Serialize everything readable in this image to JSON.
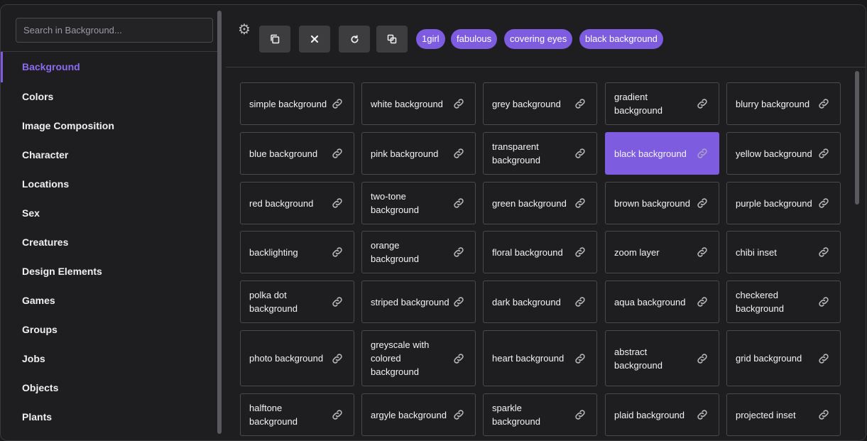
{
  "sidebar": {
    "search_placeholder": "Search in Background...",
    "items": [
      {
        "label": "Background",
        "active": true
      },
      {
        "label": "Colors"
      },
      {
        "label": "Image Composition"
      },
      {
        "label": "Character"
      },
      {
        "label": "Locations"
      },
      {
        "label": "Sex"
      },
      {
        "label": "Creatures"
      },
      {
        "label": "Design Elements"
      },
      {
        "label": "Games"
      },
      {
        "label": "Groups"
      },
      {
        "label": "Jobs"
      },
      {
        "label": "Objects"
      },
      {
        "label": "Plants"
      }
    ]
  },
  "toolbar": {
    "buttons": [
      {
        "name": "copy-button",
        "icon": "copy-icon"
      },
      {
        "name": "clear-button",
        "icon": "close-icon"
      },
      {
        "name": "refresh-button",
        "icon": "refresh-icon"
      },
      {
        "name": "duplicate-button",
        "icon": "duplicate-icon"
      }
    ],
    "tags": [
      "1girl",
      "fabulous",
      "covering eyes",
      "black background"
    ]
  },
  "cards": [
    [
      "simple background",
      "white background",
      "grey background",
      "gradient background",
      "blurry background"
    ],
    [
      "blue background",
      "pink background",
      "transparent background",
      "black background",
      "yellow background"
    ],
    [
      "red background",
      "two-tone background",
      "green background",
      "brown background",
      "purple background"
    ],
    [
      "backlighting",
      "orange background",
      "floral background",
      "zoom layer",
      "chibi inset"
    ],
    [
      "polka dot background",
      "striped background",
      "dark background",
      "aqua background",
      "checkered background"
    ],
    [
      "photo background",
      "greyscale with colored background",
      "heart background",
      "abstract background",
      "grid background"
    ],
    [
      "halftone background",
      "argyle background",
      "sparkle background",
      "plaid background",
      "projected inset"
    ]
  ],
  "selected_card": "black background",
  "colors": {
    "accent": "#7d5ce0",
    "background": "#1e1e20",
    "border": "#4a4a4e"
  }
}
